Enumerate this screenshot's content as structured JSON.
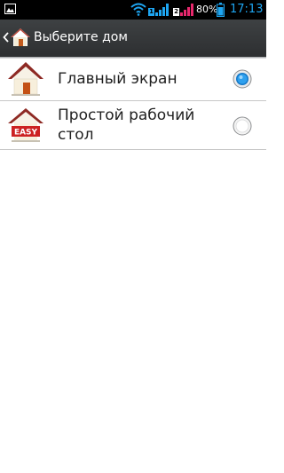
{
  "status_bar": {
    "battery_percent": "80%",
    "clock": "17:13",
    "sim1_label": "1",
    "sim2_label": "2",
    "icons": [
      "gallery-icon",
      "wifi-icon",
      "signal-icon",
      "signal-icon",
      "battery-icon"
    ]
  },
  "action_bar": {
    "title": "Выберите дом",
    "back_icon": "chevron-left-icon",
    "app_icon": "home-icon"
  },
  "home_options": [
    {
      "label": "Главный экран",
      "icon": "home-icon",
      "selected": true
    },
    {
      "label": "Простой рабочий стол",
      "icon": "easy-home-icon",
      "icon_text": "EASY",
      "selected": false
    }
  ],
  "colors": {
    "accent": "#1ea6f2",
    "action_bar": "#35383a",
    "text": "#1f1f1f"
  }
}
